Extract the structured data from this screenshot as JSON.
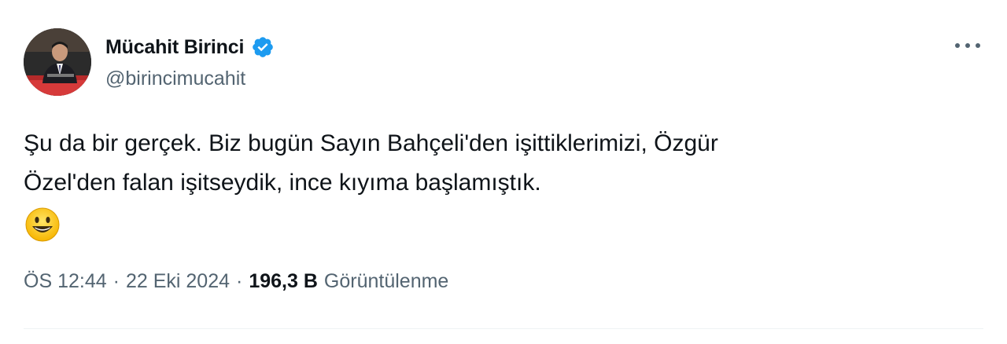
{
  "author": {
    "display_name": "Mücahit Birinci",
    "handle": "@birincimucahit",
    "verified": true,
    "avatar_icon": "profile-photo"
  },
  "tweet": {
    "lines": [
      "Şu da bir gerçek. Biz bugün Sayın Bahçeli'den işittiklerimizi, Özgür",
      "Özel'den falan işitseydik, ince kıyıma başlamıştık."
    ],
    "emoji": "grinning-face-icon"
  },
  "meta": {
    "time": "ÖS 12:44",
    "separator": "·",
    "date": "22 Eki 2024",
    "views_count": "196,3 B",
    "views_label": "Görüntülenme"
  },
  "colors": {
    "verified_blue": "#1d9bf0",
    "text_primary": "#0f1419",
    "text_secondary": "#536471",
    "divider": "#eff3f4"
  }
}
